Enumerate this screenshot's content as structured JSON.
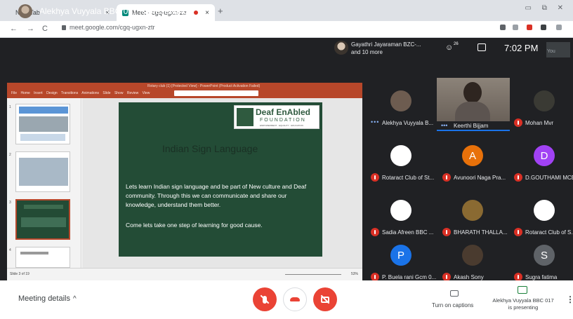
{
  "browser": {
    "tabs": [
      {
        "label": "New Tab"
      },
      {
        "label": "Meet - cgq-ugxn-ztr"
      }
    ],
    "tab_close": "×",
    "new_tab": "+",
    "window_controls": "▭ ⧉ ✕",
    "url": "meet.google.com/cgq-ugxn-ztr",
    "nav_back": "←",
    "nav_forward": "→",
    "nav_reload": "C"
  },
  "meet": {
    "presenting_title": "Alekhya Vuyyala BBC 017 is presenting",
    "join_notice_line1": "Gayathri Jayaraman BZC-...",
    "join_notice_line2": "and 10 more",
    "people_count": "26",
    "clock": "7:02 PM",
    "you_label": "You"
  },
  "presentation": {
    "window_title": "Rotary club (1) [Protected View] - PowerPoint (Product Activation Failed)",
    "menu": "File Home Insert Design Transitions Animations Slide Show Review View",
    "thumb_numbers": [
      "1",
      "2",
      "3",
      "4"
    ],
    "status_left": "Slide 3 of 19",
    "zoom": "53%",
    "slide": {
      "logo_main": "Deaf EnAbled",
      "logo_sub": "FOUNDATION",
      "logo_tag": "EMPOWERMENT · EQUALITY · EDUCATION",
      "title": "Indian Sign Language",
      "body": "Lets learn Indian sign language and be part of New culture and Deaf community. Through this we can communicate and share our knowledge, understand them better.",
      "body2": "Come lets take one step of learning for good cause."
    }
  },
  "participants": [
    {
      "name": "Alekhya Vuyyala B...",
      "initial": "",
      "color": "#6d5c50",
      "muted": false
    },
    {
      "name": "Keerthi Bijjam",
      "initial": "",
      "color": "#7a6f66",
      "muted": false
    },
    {
      "name": "Mohan Mvr",
      "initial": "",
      "color": "#3a3a34",
      "muted": true
    },
    {
      "name": "Rotaract Club of St...",
      "initial": "",
      "color": "#ffffff",
      "muted": true
    },
    {
      "name": "Avunoori Naga Pra...",
      "initial": "A",
      "color": "#e8710a",
      "muted": true
    },
    {
      "name": "D.GOUTHAMI MCE",
      "initial": "D",
      "color": "#a142f4",
      "muted": true
    },
    {
      "name": "Sadia Afreen BBC ...",
      "initial": "",
      "color": "#ffffff",
      "muted": true
    },
    {
      "name": "BHARATH THALLA...",
      "initial": "",
      "color": "#8a6a32",
      "muted": true
    },
    {
      "name": "Rotaract Club of S...",
      "initial": "",
      "color": "#ffffff",
      "muted": true
    },
    {
      "name": "P. Buela rani Gcm 0...",
      "initial": "P",
      "color": "#1a73e8",
      "muted": true
    },
    {
      "name": "Akash Sony",
      "initial": "",
      "color": "#4a3b2f",
      "muted": true
    },
    {
      "name": "Sugra fatima",
      "initial": "S",
      "color": "#5f6368",
      "muted": true
    }
  ],
  "controls": {
    "meeting_details": "Meeting details",
    "chevron": "^",
    "captions": "Turn on captions",
    "present_line1": "Alekhya Vuyyala BBC 017",
    "present_line2": "is presenting",
    "more": "⋮",
    "accent": "#ea4335"
  }
}
